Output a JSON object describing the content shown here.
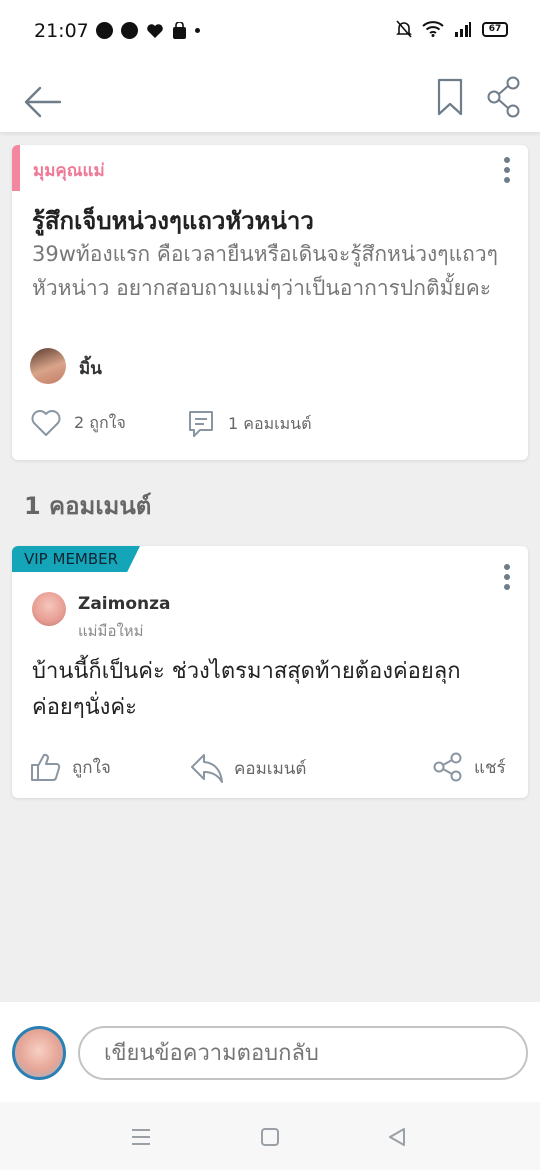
{
  "status": {
    "time": "21:07",
    "battery": "67"
  },
  "post": {
    "category": "มุมคุณแม่",
    "title": "รู้สึกเจ็บหน่วงๆแถวหัวหน่าว",
    "body": "39wท้องแรก คือเวลายืนหรือเดินจะรู้สึกหน่วงๆแถวๆหัวหน่าว อยากสอบถามแม่ๆว่าเป็นอาการปกติมั้ยคะ",
    "author": "มิ้น",
    "likes": "2 ถูกใจ",
    "comments": "1 คอมเมนต์"
  },
  "comments_heading": "1 คอมเมนต์",
  "comment": {
    "badge": "VIP MEMBER",
    "name": "Zaimonza",
    "role": "แม่มือใหม่",
    "text": "บ้านนี้ก็เป็นค่ะ ช่วงไตรมาสสุดท้ายต้องค่อยลุก ค่อยๆนั่งค่ะ",
    "like_label": "ถูกใจ",
    "reply_label": "คอมเมนต์",
    "share_label": "แชร์"
  },
  "compose": {
    "placeholder": "เขียนข้อความตอบกลับ"
  },
  "colors": {
    "accent_pink": "#ef7a97",
    "vip_teal": "#14a6b8",
    "icon_gray": "#6f7d8a"
  }
}
